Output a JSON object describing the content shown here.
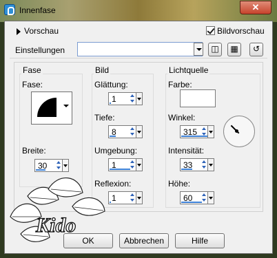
{
  "window": {
    "title": "Innenfase",
    "close_symbol": "✕"
  },
  "top": {
    "preview_label": "Vorschau",
    "image_preview_label": "Bildvorschau",
    "image_preview_checked": true,
    "settings_label": "Einstellungen",
    "settings_value": ""
  },
  "fase_group": {
    "title": "Fase",
    "fase_label": "Fase:",
    "breite_label": "Breite:",
    "breite_value": "30"
  },
  "bild_group": {
    "title": "Bild",
    "glaettung_label": "Glättung:",
    "glaettung_value": "1",
    "tiefe_label": "Tiefe:",
    "tiefe_value": "8",
    "umgebung_label": "Umgebung:",
    "umgebung_value": "1",
    "reflexion_label": "Reflexion:",
    "reflexion_value": "1"
  },
  "licht_group": {
    "title": "Lichtquelle",
    "farbe_label": "Farbe:",
    "farbe_color": "#ffffff",
    "winkel_label": "Winkel:",
    "winkel_value": "315",
    "intensitaet_label": "Intensität:",
    "intensitaet_value": "33",
    "hoehe_label": "Höhe:",
    "hoehe_value": "60"
  },
  "buttons": {
    "ok": "OK",
    "cancel": "Abbrechen",
    "help": "Hilfe"
  },
  "watermark_text": "Kido"
}
